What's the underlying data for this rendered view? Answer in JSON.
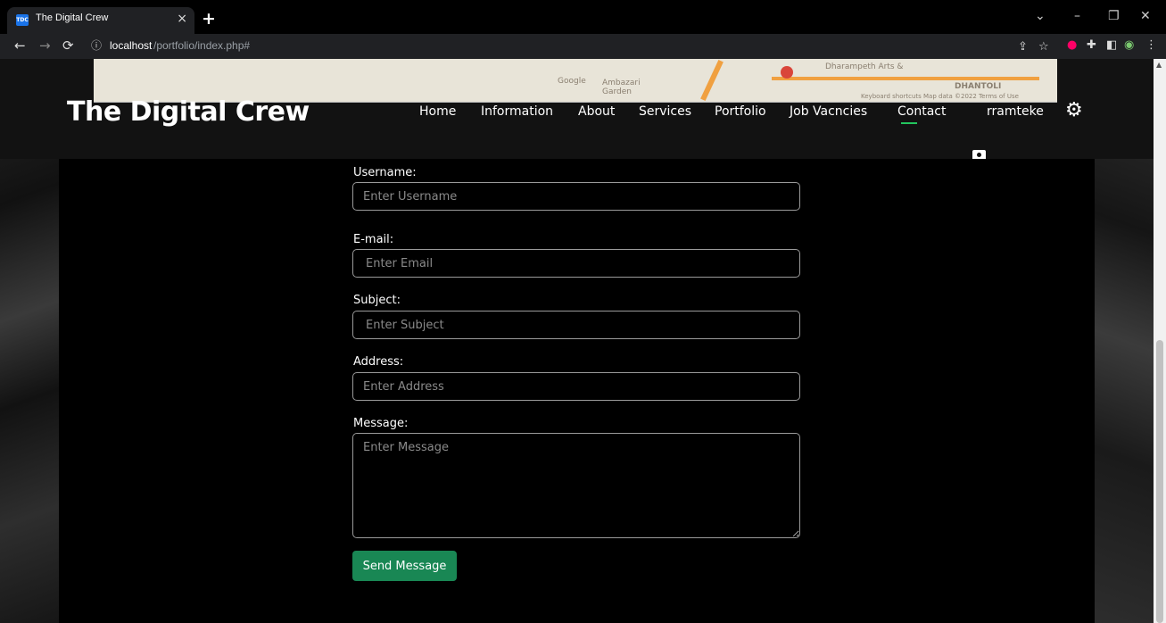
{
  "browser": {
    "tab_title": "The Digital Crew",
    "tab_favicon": "TDC",
    "tab_close": "×",
    "new_tab": "+",
    "url_host": "localhost",
    "url_path": "/portfolio/index.php#",
    "window_controls": {
      "minimize": "–",
      "restore": "❐",
      "close": "✕",
      "dropdown": "⌄"
    }
  },
  "map": {
    "labels": [
      "Dharampeth Arts &",
      "Ambazari Garden",
      "DHANTOLI",
      "Keyboard shortcuts   Map data ©2022   Terms of Use",
      "Google"
    ]
  },
  "header": {
    "brand": "The Digital Crew",
    "nav": [
      "Home",
      "Information",
      "About",
      "Services",
      "Portfolio",
      "Job Vacncies",
      "Contact"
    ],
    "active_nav": "Contact",
    "user": "rramteke",
    "accent_color": "#22c55e"
  },
  "form": {
    "fields": [
      {
        "label": "Username:",
        "placeholder": "Enter Username"
      },
      {
        "label": "E-mail:",
        "placeholder": "Enter Email"
      },
      {
        "label": "Subject:",
        "placeholder": "Enter Subject"
      },
      {
        "label": "Address:",
        "placeholder": "Enter Address"
      }
    ],
    "message_label": "Message:",
    "message_placeholder": "Enter Message",
    "submit_label": "Send Message",
    "submit_color": "#198754"
  }
}
